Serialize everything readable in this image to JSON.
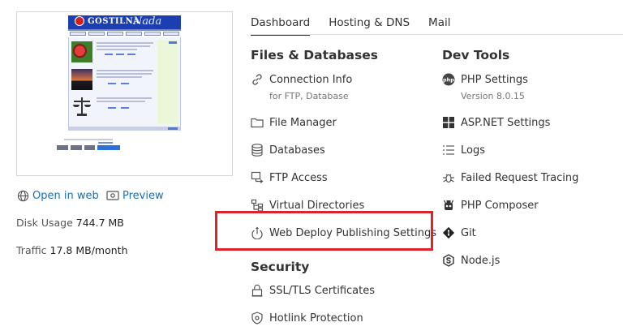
{
  "preview": {
    "site_title_a": "GOSTILNA",
    "site_title_b": "Nada"
  },
  "links": {
    "open_in_web": "Open in web",
    "preview": "Preview"
  },
  "stats": {
    "disk_usage_label": "Disk Usage",
    "disk_usage_value": "744.7 MB",
    "traffic_label": "Traffic",
    "traffic_value": "17.8 MB/month"
  },
  "tabs": [
    {
      "label": "Dashboard",
      "active": true
    },
    {
      "label": "Hosting & DNS",
      "active": false
    },
    {
      "label": "Mail",
      "active": false
    }
  ],
  "files_databases": {
    "title": "Files & Databases",
    "items": [
      {
        "label": "Connection Info",
        "sub": "for FTP, Database",
        "icon": "connection-icon"
      },
      {
        "label": "File Manager",
        "icon": "folder-icon"
      },
      {
        "label": "Databases",
        "icon": "database-icon"
      },
      {
        "label": "FTP Access",
        "icon": "ftp-icon"
      },
      {
        "label": "Virtual Directories",
        "icon": "sitemap-icon"
      },
      {
        "label": "Web Deploy Publishing Settings",
        "icon": "web-deploy-icon"
      }
    ]
  },
  "dev_tools": {
    "title": "Dev Tools",
    "items": [
      {
        "label": "PHP Settings",
        "sub": "Version 8.0.15",
        "icon": "php-icon"
      },
      {
        "label": "ASP.NET Settings",
        "icon": "windows-icon"
      },
      {
        "label": "Logs",
        "icon": "logs-icon"
      },
      {
        "label": "Failed Request Tracing",
        "icon": "bug-icon"
      },
      {
        "label": "PHP Composer",
        "icon": "composer-icon"
      },
      {
        "label": "Git",
        "icon": "git-icon"
      },
      {
        "label": "Node.js",
        "icon": "nodejs-icon"
      }
    ]
  },
  "security": {
    "title": "Security",
    "items": [
      {
        "label": "SSL/TLS Certificates",
        "icon": "ssl-icon"
      },
      {
        "label": "Hotlink Protection",
        "icon": "shield-icon"
      }
    ]
  },
  "colors": {
    "link": "#1a6fb5",
    "highlight": "#d9232d"
  }
}
